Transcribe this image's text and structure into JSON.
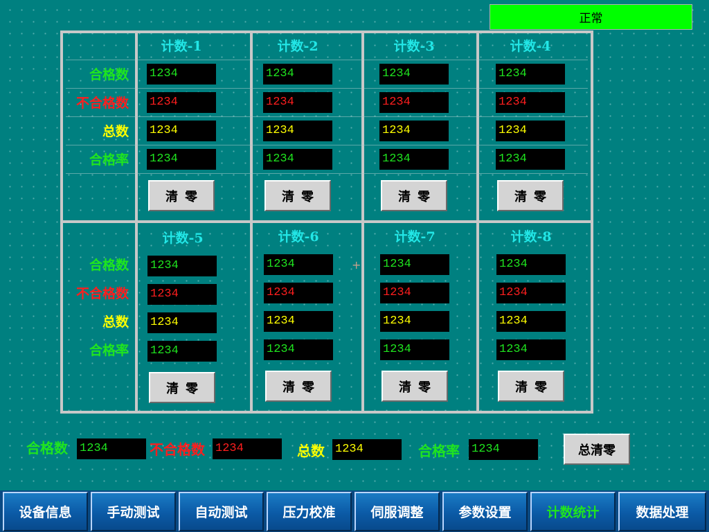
{
  "status": {
    "text": "正常",
    "color": "#00ff00"
  },
  "row_labels": [
    "合格数",
    "不合格数",
    "总数",
    "合格率"
  ],
  "counters_top": [
    {
      "title": "计数-1",
      "values": [
        "1234",
        "1234",
        "1234",
        "1234"
      ],
      "clear_label": "清零"
    },
    {
      "title": "计数-2",
      "values": [
        "1234",
        "1234",
        "1234",
        "1234"
      ],
      "clear_label": "清零"
    },
    {
      "title": "计数-3",
      "values": [
        "1234",
        "1234",
        "1234",
        "1234"
      ],
      "clear_label": "清零"
    },
    {
      "title": "计数-4",
      "values": [
        "1234",
        "1234",
        "1234",
        "1234"
      ],
      "clear_label": "清零"
    }
  ],
  "counters_bottom": [
    {
      "title": "计数-5",
      "values": [
        "1234",
        "1234",
        "1234",
        "1234"
      ],
      "clear_label": "清零"
    },
    {
      "title": "计数-6",
      "values": [
        "1234",
        "1234",
        "1234",
        "1234"
      ],
      "clear_label": "清零"
    },
    {
      "title": "计数-7",
      "values": [
        "1234",
        "1234",
        "1234",
        "1234"
      ],
      "clear_label": "清零"
    },
    {
      "title": "计数-8",
      "values": [
        "1234",
        "1234",
        "1234",
        "1234"
      ],
      "clear_label": "清零"
    }
  ],
  "summary": {
    "pass_label": "合格数",
    "pass_value": "1234",
    "fail_label": "不合格数",
    "fail_value": "1234",
    "total_label": "总数",
    "total_value": "1234",
    "rate_label": "合格率",
    "rate_value": "1234",
    "clear_all_label": "总清零"
  },
  "nav": {
    "items": [
      "设备信息",
      "手动测试",
      "自动测试",
      "压力校准",
      "伺服调整",
      "参数设置",
      "计数统计",
      "数据处理"
    ],
    "active": "计数统计"
  },
  "colors": {
    "pass": "#1fe51f",
    "fail": "#ff1e1e",
    "total": "#ffff00",
    "title": "#22e6e6",
    "background": "#008080"
  }
}
